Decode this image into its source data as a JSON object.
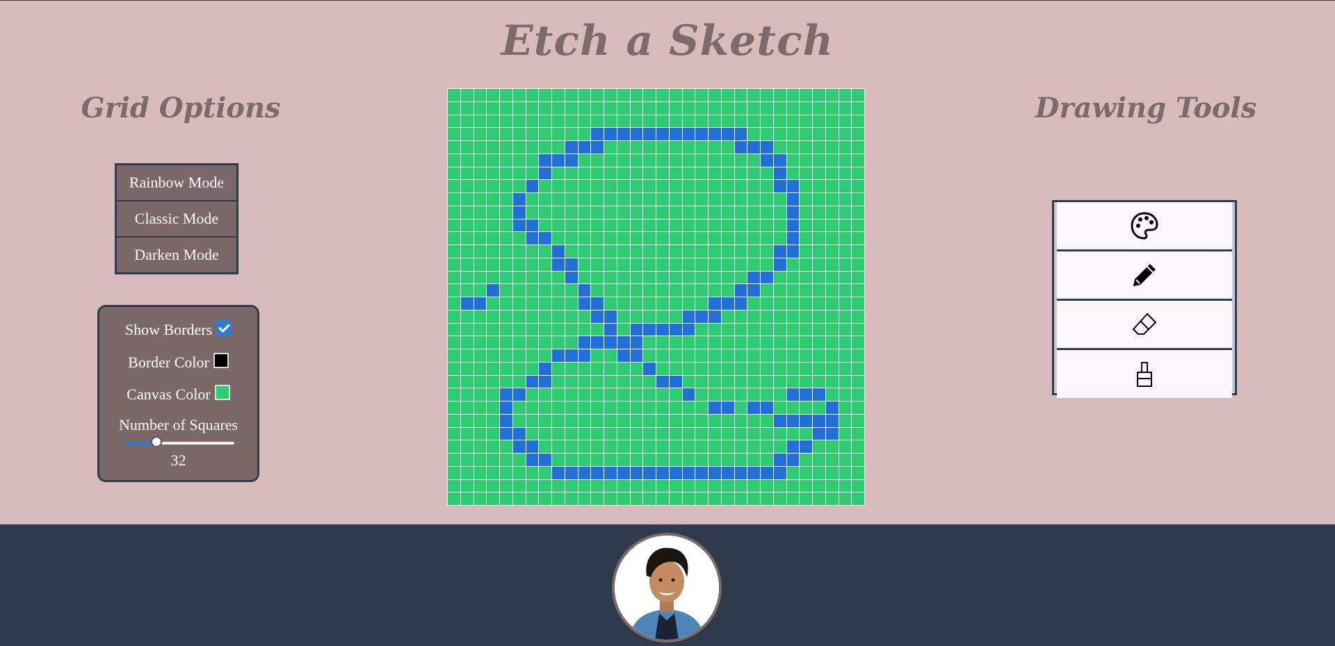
{
  "title": "Etch a Sketch",
  "grid_options": {
    "title": "Grid Options",
    "modes": [
      "Rainbow Mode",
      "Classic Mode",
      "Darken Mode"
    ],
    "show_borders_label": "Show Borders",
    "show_borders_checked": true,
    "border_color_label": "Border Color",
    "border_color": "#000000",
    "canvas_color_label": "Canvas Color",
    "canvas_color": "#2ecc71",
    "squares_label": "Number of Squares",
    "squares_value": "32",
    "squares_slider_fraction": 0.27
  },
  "drawing_tools": {
    "title": "Drawing Tools",
    "tools": [
      "palette-icon",
      "pencil-icon",
      "eraser-icon",
      "paint-bucket-icon"
    ]
  },
  "canvas": {
    "size": 32,
    "cell_color": "#2ecc71",
    "paint_color": "#1f6fd6",
    "painted_rows": [
      {
        "r": 3,
        "c": [
          11,
          12,
          13,
          14,
          15,
          16,
          17,
          18,
          19,
          20,
          21,
          22
        ]
      },
      {
        "r": 4,
        "c": [
          9,
          10,
          11,
          22,
          23,
          24
        ]
      },
      {
        "r": 5,
        "c": [
          7,
          8,
          9,
          24,
          25
        ]
      },
      {
        "r": 6,
        "c": [
          7,
          25
        ]
      },
      {
        "r": 7,
        "c": [
          6,
          25,
          26
        ]
      },
      {
        "r": 8,
        "c": [
          5,
          26
        ]
      },
      {
        "r": 9,
        "c": [
          5,
          26
        ]
      },
      {
        "r": 10,
        "c": [
          5,
          6,
          26
        ]
      },
      {
        "r": 11,
        "c": [
          6,
          7,
          26
        ]
      },
      {
        "r": 12,
        "c": [
          8,
          25,
          26
        ]
      },
      {
        "r": 13,
        "c": [
          8,
          9,
          25
        ]
      },
      {
        "r": 14,
        "c": [
          9,
          23,
          24
        ]
      },
      {
        "r": 15,
        "c": [
          3,
          10,
          22,
          23
        ]
      },
      {
        "r": 16,
        "c": [
          1,
          2,
          10,
          11,
          20,
          21,
          22
        ]
      },
      {
        "r": 17,
        "c": [
          11,
          12,
          18,
          19,
          20
        ]
      },
      {
        "r": 18,
        "c": [
          12,
          14,
          15,
          16,
          17,
          18
        ]
      },
      {
        "r": 19,
        "c": [
          10,
          11,
          12,
          13,
          14
        ]
      },
      {
        "r": 20,
        "c": [
          8,
          9,
          10,
          13,
          14
        ]
      },
      {
        "r": 21,
        "c": [
          7,
          15
        ]
      },
      {
        "r": 22,
        "c": [
          6,
          7,
          16,
          17
        ]
      },
      {
        "r": 23,
        "c": [
          4,
          5,
          18,
          26,
          27,
          28
        ]
      },
      {
        "r": 24,
        "c": [
          4,
          20,
          21,
          23,
          24,
          29
        ]
      },
      {
        "r": 25,
        "c": [
          4,
          25,
          26,
          27,
          28,
          29
        ]
      },
      {
        "r": 26,
        "c": [
          4,
          5,
          28,
          29
        ]
      },
      {
        "r": 27,
        "c": [
          5,
          6,
          26,
          27
        ]
      },
      {
        "r": 28,
        "c": [
          6,
          7,
          25,
          26
        ]
      },
      {
        "r": 29,
        "c": [
          8,
          9,
          10,
          11,
          12,
          13,
          14,
          15,
          16,
          17,
          18,
          19,
          20,
          21,
          22,
          23,
          24,
          25
        ]
      }
    ]
  },
  "footer": {
    "avatar": "profile-photo"
  }
}
